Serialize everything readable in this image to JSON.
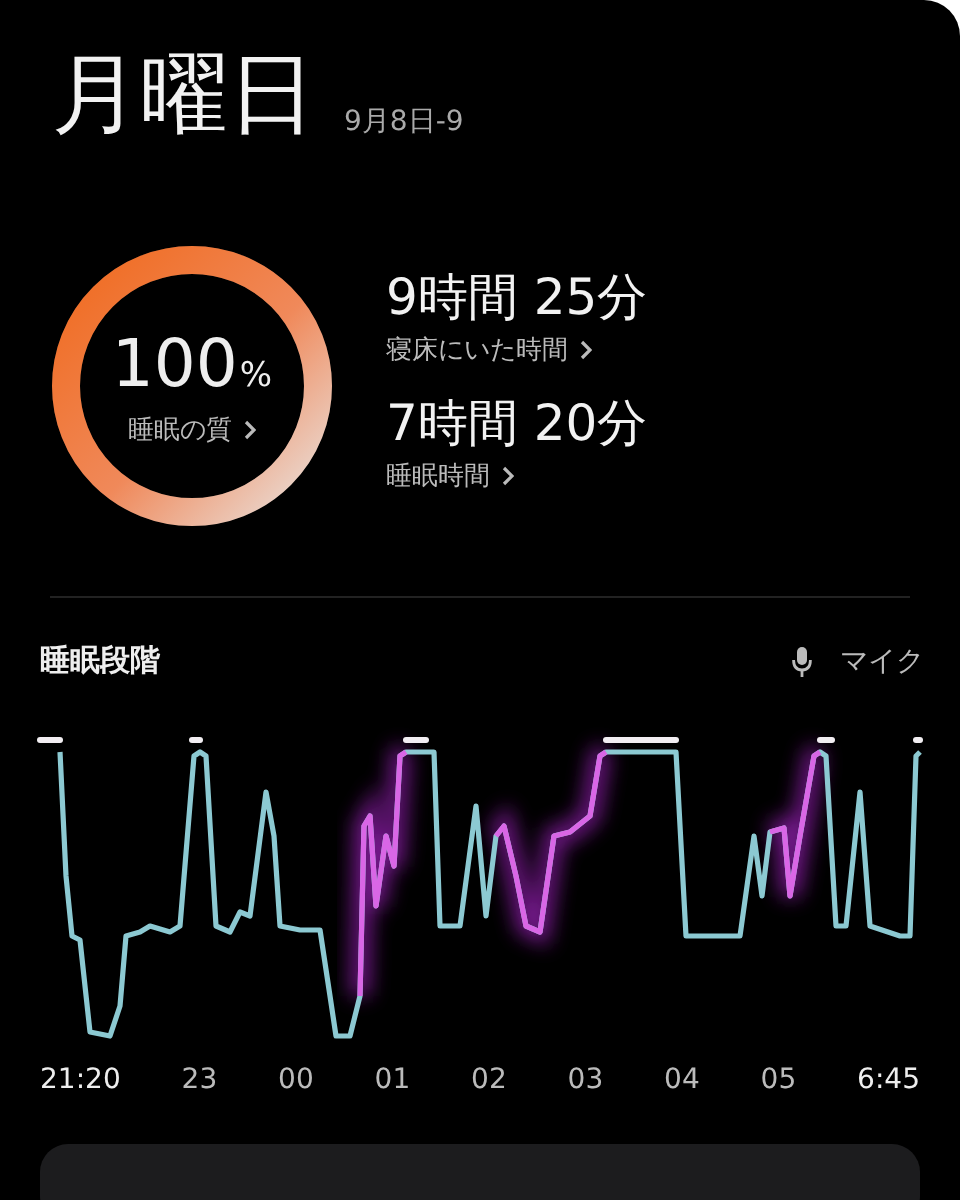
{
  "header": {
    "title": "月曜日",
    "date_range": "9月8日-9"
  },
  "quality": {
    "value": "100",
    "unit": "%",
    "label": "睡眠の質",
    "level": 1
  },
  "stats": [
    {
      "value": "9時間 25分",
      "label": "寝床にいた時間"
    },
    {
      "value": "7時間 20分",
      "label": "睡眠時間"
    }
  ],
  "stages": {
    "title": "睡眠段階",
    "source": "マイク",
    "time_labels": [
      "21:20",
      "23",
      "00",
      "01",
      "02",
      "03",
      "04",
      "05",
      "6:45"
    ]
  }
}
